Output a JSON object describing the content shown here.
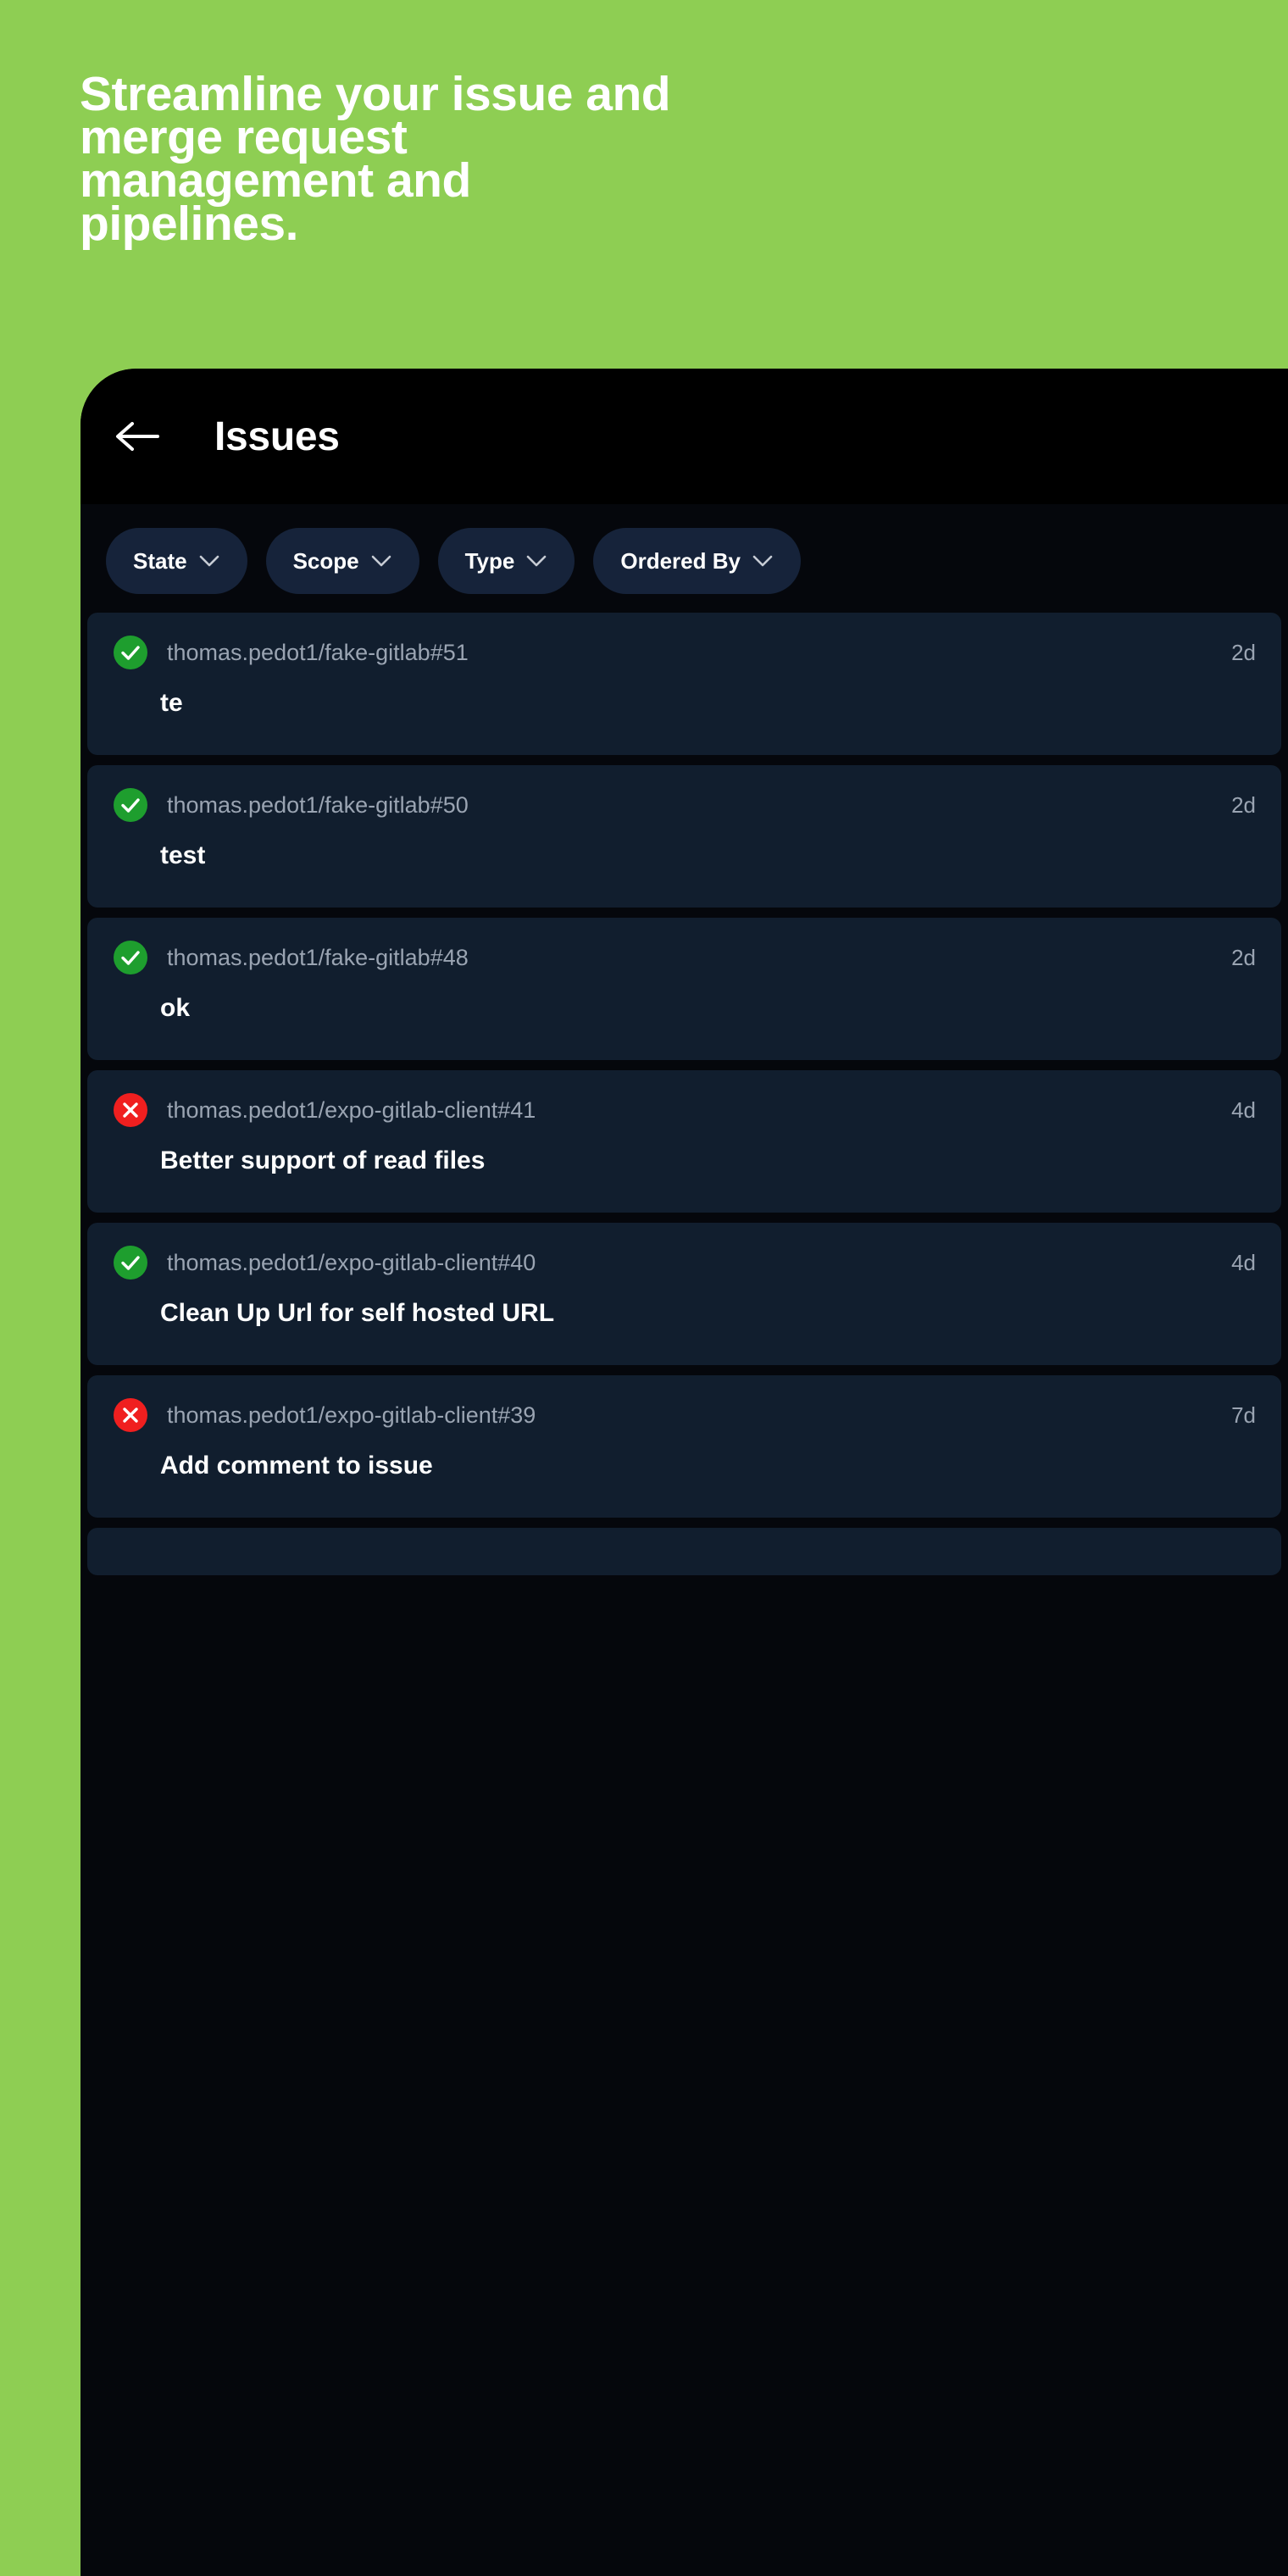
{
  "promo": {
    "headline": "Streamline your issue and merge request management and pipelines.",
    "background_color": "#8ECE53",
    "headline_color": "#FFFFFF"
  },
  "phone": {
    "header": {
      "back_icon": "arrow-left-icon",
      "title": "Issues"
    },
    "filters": [
      {
        "label": "State",
        "chevron": "chevron-down-icon"
      },
      {
        "label": "Scope",
        "chevron": "chevron-down-icon"
      },
      {
        "label": "Type",
        "chevron": "chevron-down-icon"
      },
      {
        "label": "Ordered By",
        "chevron": "chevron-down-icon"
      }
    ],
    "issues": [
      {
        "status": "closed-check-icon",
        "status_color": "#1E9E2E",
        "reference": "thomas.pedot1/fake-gitlab#51",
        "title": "te",
        "age": "2d"
      },
      {
        "status": "closed-check-icon",
        "status_color": "#1E9E2E",
        "reference": "thomas.pedot1/fake-gitlab#50",
        "title": "test",
        "age": "2d"
      },
      {
        "status": "closed-check-icon",
        "status_color": "#1E9E2E",
        "reference": "thomas.pedot1/fake-gitlab#48",
        "title": "ok",
        "age": "2d"
      },
      {
        "status": "open-x-icon",
        "status_color": "#F01F1F",
        "reference": "thomas.pedot1/expo-gitlab-client#41",
        "title": "Better support of read files",
        "age": "4d"
      },
      {
        "status": "closed-check-icon",
        "status_color": "#1E9E2E",
        "reference": "thomas.pedot1/expo-gitlab-client#40",
        "title": "Clean Up Url for self hosted URL",
        "age": "4d"
      },
      {
        "status": "open-x-icon",
        "status_color": "#F01F1F",
        "reference": "thomas.pedot1/expo-gitlab-client#39",
        "title": "Add comment to issue",
        "age": "7d"
      }
    ]
  }
}
